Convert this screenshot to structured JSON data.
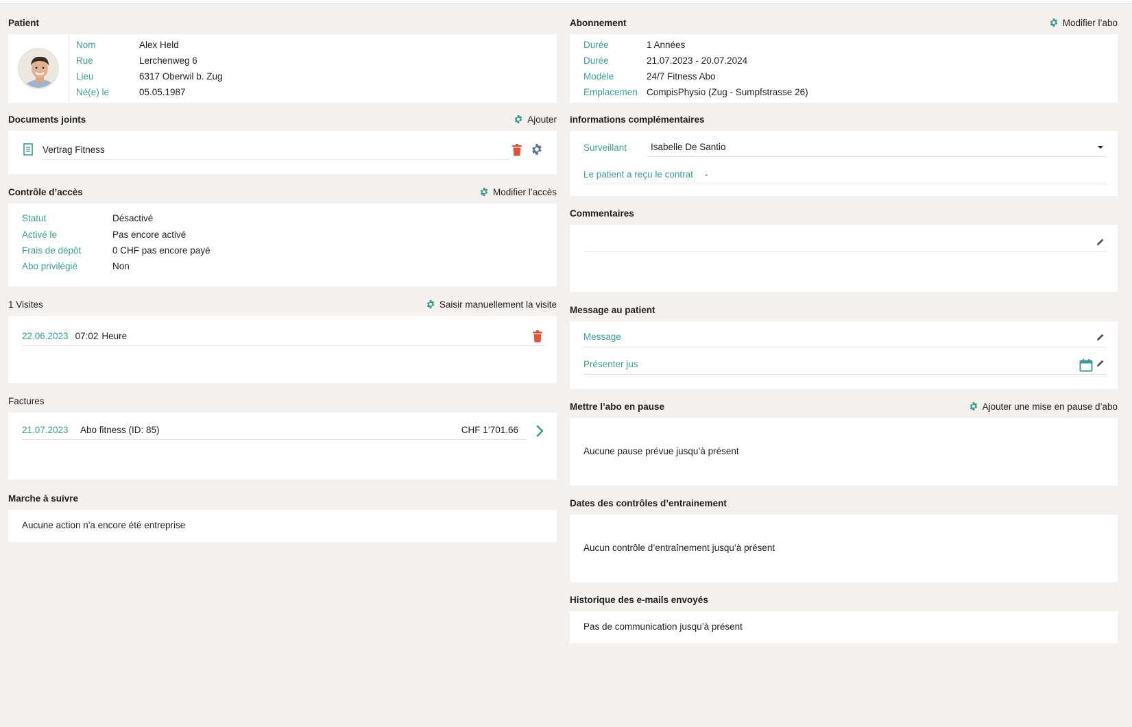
{
  "patient": {
    "title": "Patient",
    "fields": [
      {
        "label": "Nom",
        "value": "Alex Held"
      },
      {
        "label": "Rue",
        "value": "Lerchenweg 6"
      },
      {
        "label": "Lieu",
        "value": "6317 Oberwil b. Zug"
      },
      {
        "label": "Né(e) le",
        "value": "05.05.1987"
      }
    ]
  },
  "documents": {
    "title": "Documents joints",
    "action": "Ajouter",
    "items": [
      {
        "name": "Vertrag Fitness"
      }
    ]
  },
  "access": {
    "title": "Contrôle d’accès",
    "action": "Modifier l’accès",
    "fields": [
      {
        "label": "Statut",
        "value": "Désactivé"
      },
      {
        "label": "Activé le",
        "value": "Pas encore activé"
      },
      {
        "label": "Frais de dépôt",
        "value": "0 CHF pas encore payé"
      },
      {
        "label": "Abo privilégié",
        "value": "Non"
      }
    ]
  },
  "visits": {
    "title": "1 Visites",
    "action": "Saisir manuellement la visite",
    "items": [
      {
        "date": "22.06.2023",
        "time": "07:02",
        "unit": "Heure"
      }
    ]
  },
  "invoices": {
    "title": "Factures",
    "items": [
      {
        "date": "21.07.2023",
        "desc": "Abo fitness (ID: 85)",
        "amount": "CHF 1’701.66"
      }
    ]
  },
  "steps": {
    "title": "Marche à suivre",
    "empty": "Aucune action n'a encore été entreprise"
  },
  "subscription": {
    "title": "Abonnement",
    "action": "Modifier l’abo",
    "fields": [
      {
        "label": "Durée",
        "value": "1 Années"
      },
      {
        "label": "Durée",
        "value": "21.07.2023 - 20.07.2024"
      },
      {
        "label": "Modèle",
        "value": "24/7 Fitness Abo"
      },
      {
        "label": "Emplacemen",
        "value": "CompisPhysio (Zug - Sumpfstrasse 26)"
      }
    ]
  },
  "extra": {
    "title": "informations complémentaires",
    "supervisor_label": "Surveillant",
    "supervisor_value": "Isabelle De Santio",
    "contract_label": "Le patient a reçu le contrat",
    "contract_value": "-"
  },
  "comments": {
    "title": "Commentaires"
  },
  "message": {
    "title": "Message au patient",
    "message_label": "Message",
    "until_label": "Présenter jus"
  },
  "pause": {
    "title": "Mettre l’abo en pause",
    "action": "Ajouter une mise en pause d’abo",
    "empty": "Aucune pause prévue jusqu’à présent"
  },
  "training": {
    "title": "Dates des contrôles d’entrainement",
    "empty": "Aucun contrôle d’entraînement jusqu’à présent"
  },
  "emails": {
    "title": "Historique des e-mails envoyés",
    "empty": "Pas de communication jusqu’à présent"
  },
  "colors": {
    "accent": "#3f9a95",
    "danger": "#e0533d",
    "background": "#f3f0ed",
    "gear_grey": "#5b7a94"
  }
}
